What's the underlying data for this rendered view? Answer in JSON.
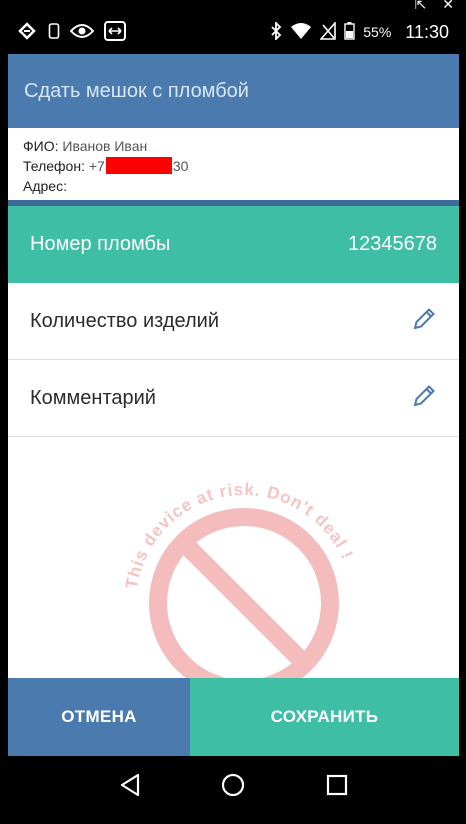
{
  "window": {
    "corner_icons": "⇱ ✕"
  },
  "status_bar": {
    "battery": "55%",
    "time": "11:30"
  },
  "app": {
    "title": "Сдать мешок с пломбой"
  },
  "customer": {
    "name_label": "ФИО:",
    "name_value": "Иванов Иван",
    "phone_label": "Телефон:",
    "phone_prefix": "+7",
    "phone_suffix": "30",
    "address_label": "Адрес:"
  },
  "fields": {
    "seal_label": "Номер пломбы",
    "seal_value": "12345678",
    "quantity_label": "Количество изделий",
    "comment_label": "Комментарий"
  },
  "watermark": {
    "text": "This device at risk. Don't deal !"
  },
  "actions": {
    "cancel_label": "ОТМЕНА",
    "save_label": "СОХРАНИТЬ"
  },
  "colors": {
    "primary": "#4a7aae",
    "accent": "#3fbea6",
    "warning_red": "#e53935"
  }
}
